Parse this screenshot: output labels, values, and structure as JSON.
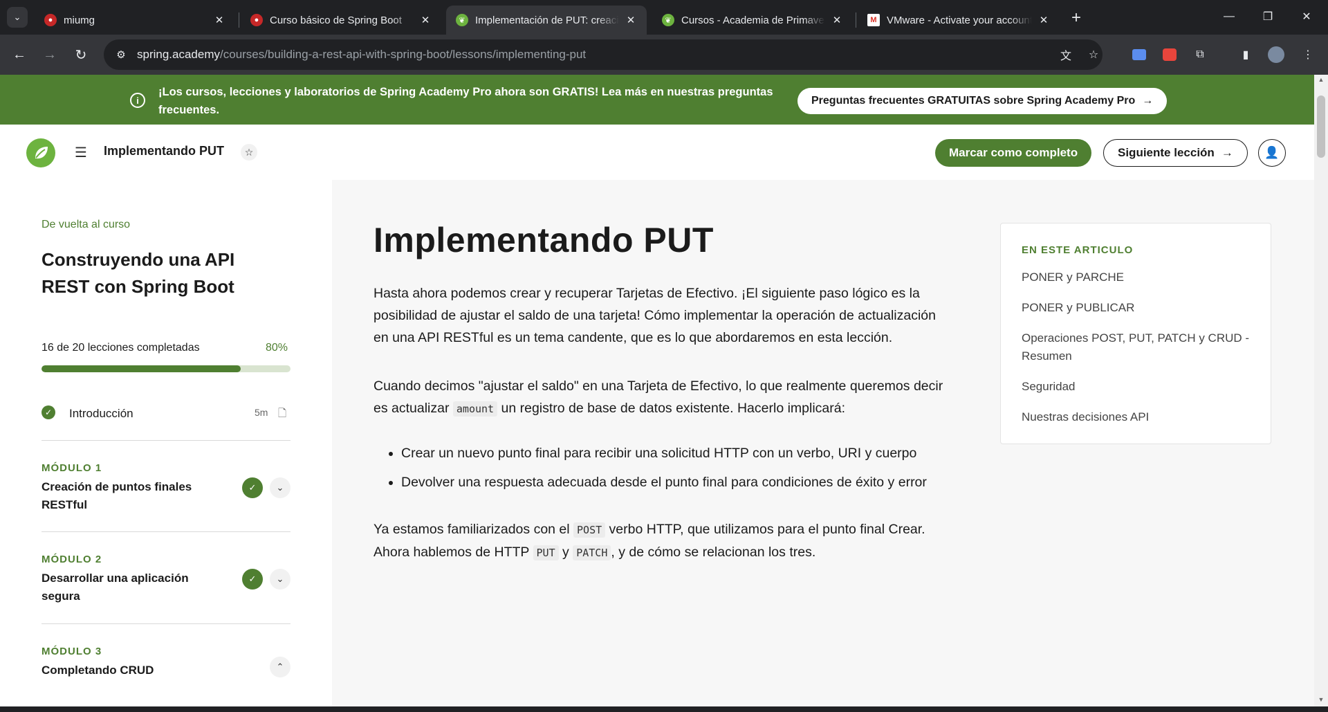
{
  "browser": {
    "tabs": [
      {
        "title": "miumg",
        "active": false
      },
      {
        "title": "Curso básico de Spring Boot",
        "active": false
      },
      {
        "title": "Implementación de PUT: creación",
        "active": true
      },
      {
        "title": "Cursos - Academia de Primavera",
        "active": false
      },
      {
        "title": "VMware - Activate your account",
        "active": false
      }
    ],
    "url_host": "spring.academy",
    "url_path": "/courses/building-a-rest-api-with-spring-boot/lessons/implementing-put"
  },
  "banner": {
    "message": "¡Los cursos, lecciones y laboratorios de Spring Academy Pro ahora son GRATIS! Lea más en nuestras preguntas frecuentes.",
    "faq_button": "Preguntas frecuentes GRATUITAS sobre Spring Academy Pro"
  },
  "header": {
    "lesson_title": "Implementando PUT",
    "complete_button": "Marcar como completo",
    "next_button": "Siguiente lección"
  },
  "sidebar": {
    "back_link": "De vuelta al curso",
    "course_title": "Construyendo una API REST con Spring Boot",
    "progress_text": "16 de 20 lecciones completadas",
    "progress_pct": "80%",
    "progress_value": 0.8,
    "intro": {
      "label": "Introducción",
      "duration": "5m"
    },
    "modules": [
      {
        "label": "MÓDULO 1",
        "title": "Creación de puntos finales RESTful",
        "completed": true,
        "expanded": false
      },
      {
        "label": "MÓDULO 2",
        "title": "Desarrollar una aplicación segura",
        "completed": true,
        "expanded": false
      },
      {
        "label": "MÓDULO 3",
        "title": "Completando CRUD",
        "completed": false,
        "expanded": true
      }
    ]
  },
  "article": {
    "title": "Implementando PUT",
    "p1": "Hasta ahora podemos crear y recuperar Tarjetas de Efectivo. ¡El siguiente paso lógico es la posibilidad de ajustar el saldo de una tarjeta! Cómo implementar la operación de actualización en una API RESTful es un tema candente, que es lo que abordaremos en esta lección.",
    "p2_a": "Cuando decimos \"ajustar el saldo\" en una Tarjeta de Efectivo, lo que realmente queremos decir es actualizar ",
    "p2_code": "amount",
    "p2_b": " un registro de base de datos existente. Hacerlo implicará:",
    "bullets": [
      "Crear un nuevo punto final para recibir una solicitud HTTP con un verbo, URI y cuerpo",
      "Devolver una respuesta adecuada desde el punto final para condiciones de éxito y error"
    ],
    "p3_a": "Ya estamos familiarizados con el ",
    "p3_code1": "POST",
    "p3_b": " verbo HTTP, que utilizamos para el punto final Crear. Ahora hablemos de HTTP ",
    "p3_code2": "PUT",
    "p3_c": " y ",
    "p3_code3": "PATCH",
    "p3_d": ", y de cómo se relacionan los tres."
  },
  "toc": {
    "heading": "EN ESTE ARTICULO",
    "items": [
      "PONER y PARCHE",
      "PONER y PUBLICAR",
      "Operaciones POST, PUT, PATCH y CRUD - Resumen",
      "Seguridad",
      "Nuestras decisiones API"
    ]
  },
  "colors": {
    "brand_green": "#4f7f31",
    "browser_dark": "#202124"
  }
}
